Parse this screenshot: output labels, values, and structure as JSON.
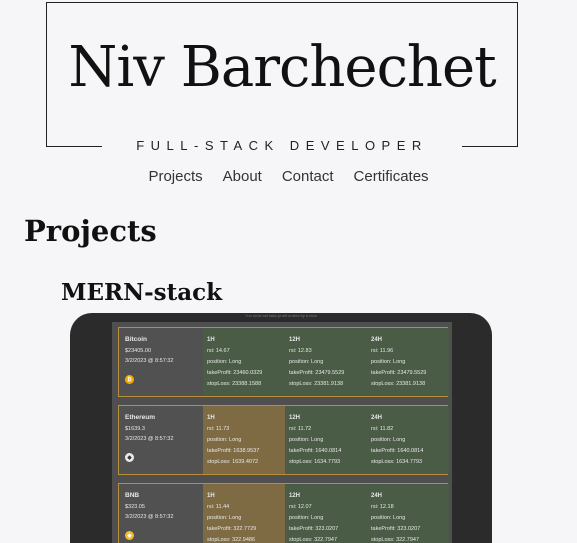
{
  "header": {
    "name": "Niv Barchechet",
    "tagline": "FULL-STACK DEVELOPER"
  },
  "nav": {
    "projects": "Projects",
    "about": "About",
    "contact": "Contact",
    "certificates": "Certificates"
  },
  "main": {
    "title": "Projects",
    "subtitle": "MERN-stack"
  },
  "screenshot": {
    "caption": "You must set take-profit orders by a click",
    "coins": [
      {
        "name": "Bitcoin",
        "price": "$23405.00",
        "time": "3/2/2023 @ 8:57:32",
        "logo_color": "#f2a900",
        "logo_glyph": "₿",
        "timeframes": [
          {
            "label": "1H",
            "rsi": "rsi: 14.67",
            "position": "position: Long",
            "take": "takeProfit: 23460.0329",
            "stop": "stopLoss: 23388.1588",
            "tone": "green"
          },
          {
            "label": "12H",
            "rsi": "rsi: 12.83",
            "position": "position: Long",
            "take": "takeProfit: 23479.5529",
            "stop": "stopLoss: 23381.9138",
            "tone": "green"
          },
          {
            "label": "24H",
            "rsi": "rsi: 11.96",
            "position": "position: Long",
            "take": "takeProfit: 23479.5529",
            "stop": "stopLoss: 23381.9138",
            "tone": "green"
          }
        ]
      },
      {
        "name": "Ethereum",
        "price": "$1639.3",
        "time": "3/2/2023 @ 8:57:32",
        "logo_color": "#eaeaea",
        "logo_glyph": "◆",
        "timeframes": [
          {
            "label": "1H",
            "rsi": "rsi: 11.73",
            "position": "position: Long",
            "take": "takeProfit: 1638.9537",
            "stop": "stopLoss: 1639.4072",
            "tone": "amber"
          },
          {
            "label": "12H",
            "rsi": "rsi: 11.72",
            "position": "position: Long",
            "take": "takeProfit: 1640.0814",
            "stop": "stopLoss: 1634.7793",
            "tone": "green"
          },
          {
            "label": "24H",
            "rsi": "rsi: 11.82",
            "position": "position: Long",
            "take": "takeProfit: 1640.0814",
            "stop": "stopLoss: 1634.7793",
            "tone": "green"
          }
        ]
      },
      {
        "name": "BNB",
        "price": "$323.05",
        "time": "3/2/2023 @ 8:57:32",
        "logo_color": "#f3ba2f",
        "logo_glyph": "◈",
        "timeframes": [
          {
            "label": "1H",
            "rsi": "rsi: 11.44",
            "position": "position: Long",
            "take": "takeProfit: 322.7729",
            "stop": "stopLoss: 322.9486",
            "tone": "amber"
          },
          {
            "label": "12H",
            "rsi": "rsi: 12.07",
            "position": "position: Long",
            "take": "takeProfit: 323.0207",
            "stop": "stopLoss: 322.7947",
            "tone": "green"
          },
          {
            "label": "24H",
            "rsi": "rsi: 12.18",
            "position": "position: Long",
            "take": "takeProfit: 323.0207",
            "stop": "stopLoss: 322.7947",
            "tone": "green"
          }
        ]
      }
    ]
  }
}
